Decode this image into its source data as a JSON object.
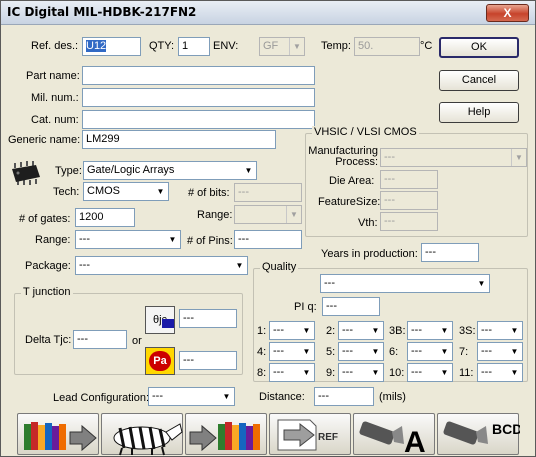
{
  "window": {
    "title": "IC Digital   MIL-HDBK-217FN2",
    "close_label": "X"
  },
  "fields": {
    "ref_des": {
      "label": "Ref. des.:",
      "value": "U12"
    },
    "qty": {
      "label": "QTY:",
      "value": "1"
    },
    "env": {
      "label": "ENV:",
      "value": "GF"
    },
    "temp": {
      "label": "Temp:",
      "value": "50.",
      "unit": "°C"
    },
    "part_name": {
      "label": "Part name:",
      "value": ""
    },
    "mil_num": {
      "label": "Mil. num.:",
      "value": ""
    },
    "cat_num": {
      "label": "Cat. num:",
      "value": ""
    },
    "generic_name": {
      "label": "Generic name:",
      "value": "LM299"
    },
    "type": {
      "label": "Type:",
      "value": "Gate/Logic Arrays"
    },
    "tech": {
      "label": "Tech:",
      "value": "CMOS"
    },
    "num_bits": {
      "label": "# of bits:",
      "value": "---"
    },
    "num_gates": {
      "label": "# of gates:",
      "value": "1200"
    },
    "range1": {
      "label": "Range:",
      "value": ""
    },
    "range2": {
      "label": "Range:",
      "value": "---"
    },
    "num_pins": {
      "label": "# of Pins:",
      "value": "---"
    },
    "package": {
      "label": "Package:",
      "value": "---"
    },
    "years": {
      "label": "Years in production:",
      "value": "---"
    },
    "lead_config": {
      "label": "Lead Configuration:",
      "value": "---"
    },
    "distance": {
      "label": "Distance:",
      "value": "---",
      "unit": "(mils)"
    }
  },
  "buttons": {
    "ok": "OK",
    "cancel": "Cancel",
    "help": "Help"
  },
  "vhsic": {
    "title": "VHSIC / VLSI CMOS",
    "mfg_process": {
      "label": "Manufacturing Process:",
      "value": "---"
    },
    "die_area": {
      "label": "Die Area:",
      "value": "---"
    },
    "feature_size": {
      "label": "FeatureSize:",
      "value": "---"
    },
    "vth": {
      "label": "Vth:",
      "value": "---"
    }
  },
  "tjunction": {
    "title": "T junction",
    "delta_label": "Delta Tjc:",
    "delta_value": "---",
    "or_label": "or",
    "jc_value": "---",
    "pa_value": "---",
    "jc_icon_text": "θjc",
    "pa_icon_text": "Pa"
  },
  "quality": {
    "title": "Quality",
    "main_value": "---",
    "piq_label": "PI q:",
    "piq_value": "---",
    "rows": [
      [
        {
          "label": "1:",
          "value": "---"
        },
        {
          "label": "2:",
          "value": "---"
        },
        {
          "label": "3B:",
          "value": "---"
        },
        {
          "label": "3S:",
          "value": "---"
        }
      ],
      [
        {
          "label": "4:",
          "value": "---"
        },
        {
          "label": "5:",
          "value": "---"
        },
        {
          "label": "6:",
          "value": "---"
        },
        {
          "label": "7:",
          "value": "---"
        }
      ],
      [
        {
          "label": "8:",
          "value": "---"
        },
        {
          "label": "9:",
          "value": "---"
        },
        {
          "label": "10:",
          "value": "---"
        },
        {
          "label": "11:",
          "value": "---"
        }
      ]
    ]
  },
  "toolbar": {
    "xref_text": "REF",
    "letter_a": "A",
    "letters_bcd": "BCD"
  },
  "colors": {
    "accent_selection": "#316ac5",
    "close_button": "#c7432b"
  }
}
